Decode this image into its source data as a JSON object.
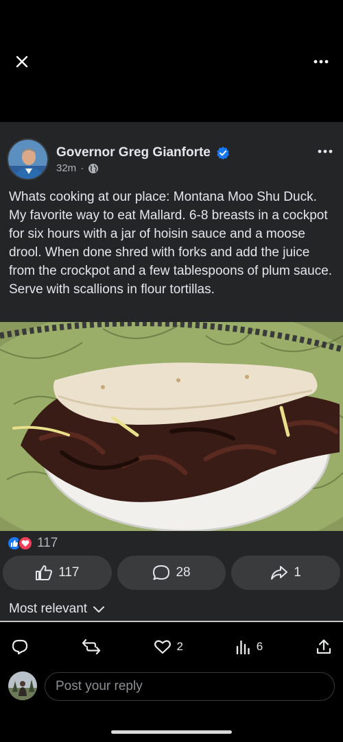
{
  "post": {
    "author": "Governor Greg Gianforte",
    "time": "32m",
    "separator": "·",
    "text": "Whats cooking at our place: Montana Moo Shu Duck. My favorite way to eat Mallard. 6-8 breasts in a cockpot for six hours with a jar of hoisin sauce and a moose drool. When done shred with forks and add the juice from the crockpot and a few tablespoons of plum sauce. Serve with scallions in flour tortillas.",
    "reaction_count": "117",
    "actions": {
      "like_count": "117",
      "comment_count": "28",
      "share_count": "1"
    },
    "sort_label": "Most relevant"
  },
  "bottom_bar": {
    "like_count": "2",
    "views_count": "6"
  },
  "reply": {
    "placeholder": "Post your reply"
  },
  "colors": {
    "accent_blue": "#1877f2",
    "love_red": "#f33e58",
    "card_bg": "#242526",
    "button_bg": "#3a3b3c"
  },
  "icons": [
    "close-icon",
    "more-icon",
    "globe-icon",
    "verified-icon",
    "like-icon",
    "comment-icon",
    "share-icon",
    "chevron-down-icon",
    "reply-icon",
    "repost-icon",
    "heart-icon",
    "views-icon",
    "upload-icon"
  ]
}
